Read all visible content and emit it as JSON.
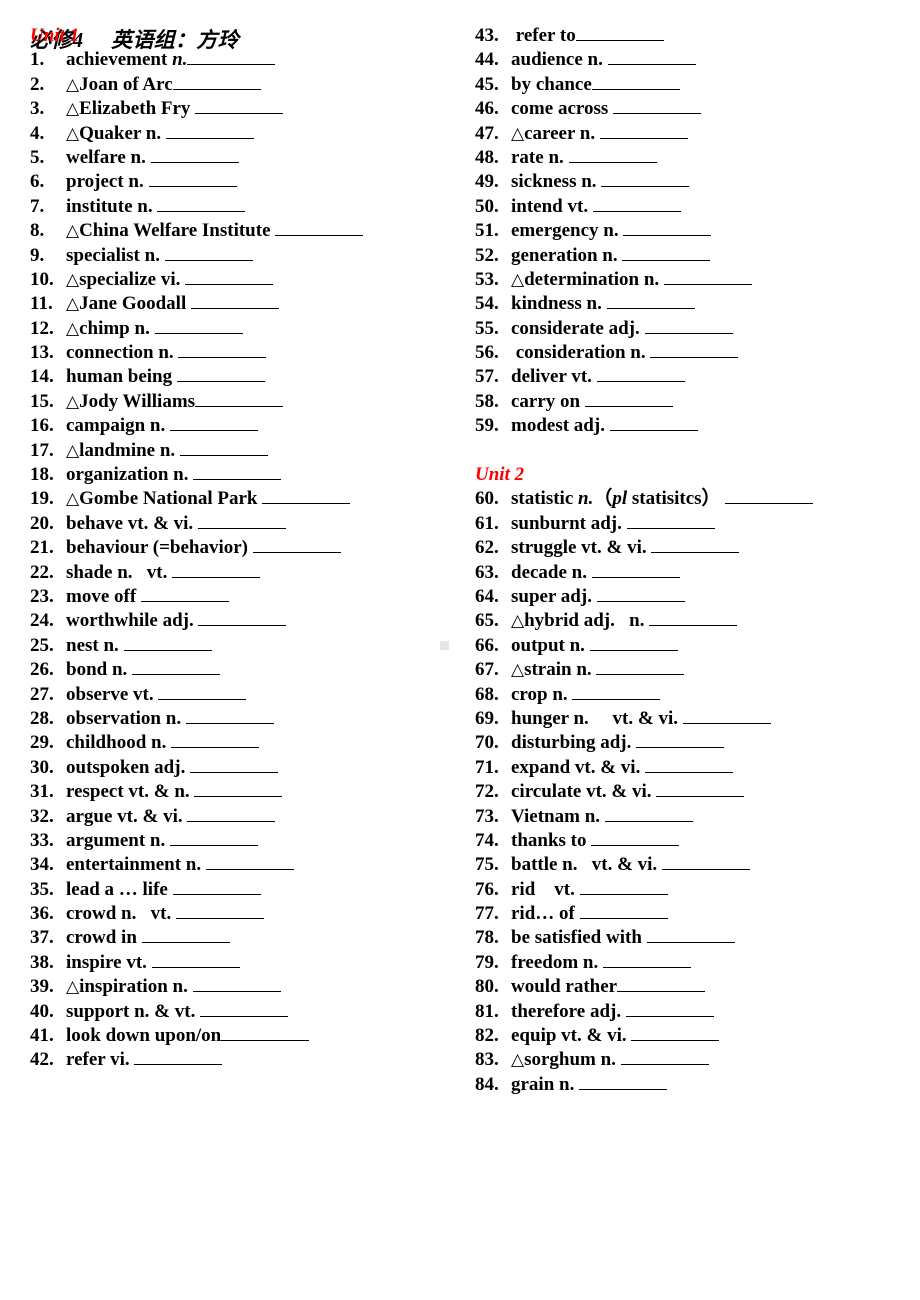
{
  "header": {
    "title": "必修4     英语组：方玲"
  },
  "artifact": {
    "color": "#e6e6e6"
  },
  "accent_color": "#ff0000",
  "left_column": {
    "unit_heading": "Unit 1",
    "items": [
      {
        "num": "1.",
        "tri": false,
        "term": "achievement ",
        "pos_italic": "n.",
        "gap_before_blank": false,
        "blank": 88
      },
      {
        "num": "2.",
        "tri": true,
        "term": "Joan of Arc",
        "gap_before_blank": false,
        "blank": 88
      },
      {
        "num": "3.",
        "tri": true,
        "term": "Elizabeth Fry",
        "gap_before_blank": true,
        "blank": 88
      },
      {
        "num": "4.",
        "tri": true,
        "term": "Quaker n.",
        "gap_before_blank": true,
        "blank": 88
      },
      {
        "num": "5.",
        "tri": false,
        "term": "welfare n.",
        "gap_before_blank": true,
        "blank": 88
      },
      {
        "num": "6.",
        "tri": false,
        "term": "project n.",
        "gap_before_blank": true,
        "blank": 88
      },
      {
        "num": "7.",
        "tri": false,
        "term": "institute n.",
        "gap_before_blank": true,
        "blank": 88
      },
      {
        "num": "8.",
        "tri": true,
        "term": "China Welfare Institute",
        "gap_before_blank": true,
        "blank": 88
      },
      {
        "num": "9.",
        "tri": false,
        "term": "specialist n.",
        "gap_before_blank": true,
        "blank": 88
      },
      {
        "num": "10.",
        "tri": true,
        "term": "specialize vi.",
        "gap_before_blank": true,
        "blank": 88
      },
      {
        "num": "11.",
        "tri": true,
        "term": "Jane Goodall",
        "gap_before_blank": true,
        "blank": 88
      },
      {
        "num": "12.",
        "tri": true,
        "term": "chimp n.",
        "gap_before_blank": true,
        "blank": 88
      },
      {
        "num": "13.",
        "tri": false,
        "term": "connection n.",
        "gap_before_blank": true,
        "blank": 88
      },
      {
        "num": "14.",
        "tri": false,
        "term": "human being",
        "gap_before_blank": true,
        "blank": 88
      },
      {
        "num": "15.",
        "tri": true,
        "term": "Jody Williams",
        "gap_before_blank": false,
        "blank": 88
      },
      {
        "num": "16.",
        "tri": false,
        "term": "campaign n.",
        "gap_before_blank": true,
        "blank": 88
      },
      {
        "num": "17.",
        "tri": true,
        "term": "landmine n.",
        "gap_before_blank": true,
        "blank": 88
      },
      {
        "num": "18.",
        "tri": false,
        "term": "organization n.",
        "gap_before_blank": true,
        "blank": 88
      },
      {
        "num": "19.",
        "tri": true,
        "term": "Gombe National Park",
        "gap_before_blank": true,
        "blank": 88
      },
      {
        "num": "20.",
        "tri": false,
        "term": "behave vt. & vi.",
        "gap_before_blank": true,
        "blank": 88
      },
      {
        "num": "21.",
        "tri": false,
        "term": "behaviour (=behavior)",
        "gap_before_blank": true,
        "blank": 88
      },
      {
        "num": "22.",
        "tri": false,
        "term": "shade n.   vt.",
        "gap_before_blank": true,
        "blank": 88
      },
      {
        "num": "23.",
        "tri": false,
        "term": "move off",
        "gap_before_blank": true,
        "blank": 88
      },
      {
        "num": "24.",
        "tri": false,
        "term": "worthwhile adj.",
        "gap_before_blank": true,
        "blank": 88
      },
      {
        "num": "25.",
        "tri": false,
        "term": "nest n.",
        "gap_before_blank": true,
        "blank": 88
      },
      {
        "num": "26.",
        "tri": false,
        "term": "bond n.",
        "gap_before_blank": true,
        "blank": 88
      },
      {
        "num": "27.",
        "tri": false,
        "term": "observe vt.",
        "gap_before_blank": true,
        "blank": 88
      },
      {
        "num": "28.",
        "tri": false,
        "term": "observation n.",
        "gap_before_blank": true,
        "blank": 88
      },
      {
        "num": "29.",
        "tri": false,
        "term": "childhood n.",
        "gap_before_blank": true,
        "blank": 88
      },
      {
        "num": "30.",
        "tri": false,
        "term": "outspoken adj.",
        "gap_before_blank": true,
        "blank": 88
      },
      {
        "num": "31.",
        "tri": false,
        "term": "respect vt. & n.",
        "gap_before_blank": true,
        "blank": 88
      },
      {
        "num": "32.",
        "tri": false,
        "term": "argue vt. & vi.",
        "gap_before_blank": true,
        "blank": 88
      },
      {
        "num": "33.",
        "tri": false,
        "term": "argument n.",
        "gap_before_blank": true,
        "blank": 88
      },
      {
        "num": "34.",
        "tri": false,
        "term": "entertainment n.",
        "gap_before_blank": true,
        "blank": 88
      },
      {
        "num": "35.",
        "tri": false,
        "term": "lead a … life",
        "gap_before_blank": true,
        "blank": 88
      },
      {
        "num": "36.",
        "tri": false,
        "term": "crowd n.   vt.",
        "gap_before_blank": true,
        "blank": 88
      },
      {
        "num": "37.",
        "tri": false,
        "term": "crowd in",
        "gap_before_blank": true,
        "blank": 88
      },
      {
        "num": "38.",
        "tri": false,
        "term": "inspire vt.",
        "gap_before_blank": true,
        "blank": 88
      },
      {
        "num": "39.",
        "tri": true,
        "term": "inspiration n.",
        "gap_before_blank": true,
        "blank": 88
      },
      {
        "num": "40.",
        "tri": false,
        "term": "support n. & vt.",
        "gap_before_blank": true,
        "blank": 88
      },
      {
        "num": "41.",
        "tri": false,
        "term": "look down upon/on",
        "gap_before_blank": false,
        "blank": 88
      },
      {
        "num": "42.",
        "tri": false,
        "term": "refer vi.",
        "gap_before_blank": true,
        "blank": 88
      }
    ]
  },
  "right_column": {
    "unit_heading": "Unit 2",
    "items_part1": [
      {
        "num": "43.",
        "tri": false,
        "term": " refer to",
        "gap_before_blank": false,
        "blank": 88
      },
      {
        "num": "44.",
        "tri": false,
        "term": "audience n.",
        "gap_before_blank": true,
        "blank": 88
      },
      {
        "num": "45.",
        "tri": false,
        "term": "by chance",
        "gap_before_blank": false,
        "blank": 88
      },
      {
        "num": "46.",
        "tri": false,
        "term": "come across",
        "gap_before_blank": true,
        "blank": 88
      },
      {
        "num": "47.",
        "tri": true,
        "term": "career n.",
        "gap_before_blank": true,
        "blank": 88
      },
      {
        "num": "48.",
        "tri": false,
        "term": "rate n.",
        "gap_before_blank": true,
        "blank": 88
      },
      {
        "num": "49.",
        "tri": false,
        "term": "sickness n.",
        "gap_before_blank": true,
        "blank": 88
      },
      {
        "num": "50.",
        "tri": false,
        "term": "intend vt.",
        "gap_before_blank": true,
        "blank": 88
      },
      {
        "num": "51.",
        "tri": false,
        "term": "emergency n.",
        "gap_before_blank": true,
        "blank": 88
      },
      {
        "num": "52.",
        "tri": false,
        "term": "generation n.",
        "gap_before_blank": true,
        "blank": 88
      },
      {
        "num": "53.",
        "tri": true,
        "term": "determination n.",
        "gap_before_blank": true,
        "blank": 88
      },
      {
        "num": "54.",
        "tri": false,
        "term": "kindness n.",
        "gap_before_blank": true,
        "blank": 88
      },
      {
        "num": "55.",
        "tri": false,
        "term": "considerate adj.",
        "gap_before_blank": true,
        "blank": 88
      },
      {
        "num": "56.",
        "tri": false,
        "term": " consideration n.",
        "gap_before_blank": true,
        "blank": 88
      },
      {
        "num": "57.",
        "tri": false,
        "term": "deliver vt.",
        "gap_before_blank": true,
        "blank": 88
      },
      {
        "num": "58.",
        "tri": false,
        "term": "carry on",
        "gap_before_blank": true,
        "blank": 88
      },
      {
        "num": "59.",
        "tri": false,
        "term": "modest adj.",
        "gap_before_blank": true,
        "blank": 88
      }
    ],
    "items_part2": [
      {
        "num": "60.",
        "tri": false,
        "term": "statistic ",
        "pos_italic": "n.",
        "term_after": "（",
        "term_italic2": "pl",
        "term_after2": " statisitcs）",
        "gap_before_blank": true,
        "blank": 88
      },
      {
        "num": "61.",
        "tri": false,
        "term": "sunburnt adj.",
        "gap_before_blank": true,
        "blank": 88
      },
      {
        "num": "62.",
        "tri": false,
        "term": "struggle vt. & vi.",
        "gap_before_blank": true,
        "blank": 88
      },
      {
        "num": "63.",
        "tri": false,
        "term": "decade n.",
        "gap_before_blank": true,
        "blank": 88
      },
      {
        "num": "64.",
        "tri": false,
        "term": "super adj.",
        "gap_before_blank": true,
        "blank": 88
      },
      {
        "num": "65.",
        "tri": true,
        "term": "hybrid adj.   n.",
        "gap_before_blank": true,
        "blank": 88
      },
      {
        "num": "66.",
        "tri": false,
        "term": "output n.",
        "gap_before_blank": true,
        "blank": 88
      },
      {
        "num": "67.",
        "tri": true,
        "term": "strain n.",
        "gap_before_blank": true,
        "blank": 88
      },
      {
        "num": "68.",
        "tri": false,
        "term": "crop n.",
        "gap_before_blank": true,
        "blank": 88
      },
      {
        "num": "69.",
        "tri": false,
        "term": "hunger n.     vt. & vi.",
        "gap_before_blank": true,
        "blank": 88
      },
      {
        "num": "70.",
        "tri": false,
        "term": "disturbing adj.",
        "gap_before_blank": true,
        "blank": 88
      },
      {
        "num": "71.",
        "tri": false,
        "term": "expand vt. & vi.",
        "gap_before_blank": true,
        "blank": 88
      },
      {
        "num": "72.",
        "tri": false,
        "term": "circulate vt. & vi.",
        "gap_before_blank": true,
        "blank": 88
      },
      {
        "num": "73.",
        "tri": false,
        "term": "Vietnam n.",
        "gap_before_blank": true,
        "blank": 88
      },
      {
        "num": "74.",
        "tri": false,
        "term": "thanks to",
        "gap_before_blank": true,
        "blank": 88
      },
      {
        "num": "75.",
        "tri": false,
        "term": "battle n.   vt. & vi.",
        "gap_before_blank": true,
        "blank": 88
      },
      {
        "num": "76.",
        "tri": false,
        "term": "rid    vt.",
        "gap_before_blank": true,
        "blank": 88
      },
      {
        "num": "77.",
        "tri": false,
        "term": "rid… of",
        "gap_before_blank": true,
        "blank": 88
      },
      {
        "num": "78.",
        "tri": false,
        "term": "be satisfied with",
        "gap_before_blank": true,
        "blank": 88
      },
      {
        "num": "79.",
        "tri": false,
        "term": "freedom n.",
        "gap_before_blank": true,
        "blank": 88
      },
      {
        "num": "80.",
        "tri": false,
        "term": "would rather",
        "gap_before_blank": false,
        "blank": 88
      },
      {
        "num": "81.",
        "tri": false,
        "term": "therefore adj.",
        "gap_before_blank": true,
        "blank": 88
      },
      {
        "num": "82.",
        "tri": false,
        "term": "equip vt. & vi.",
        "gap_before_blank": true,
        "blank": 88
      },
      {
        "num": "83.",
        "tri": true,
        "term": "sorghum n.",
        "gap_before_blank": true,
        "blank": 88
      },
      {
        "num": "84.",
        "tri": false,
        "term": "grain n.",
        "gap_before_blank": true,
        "blank": 88
      }
    ]
  }
}
